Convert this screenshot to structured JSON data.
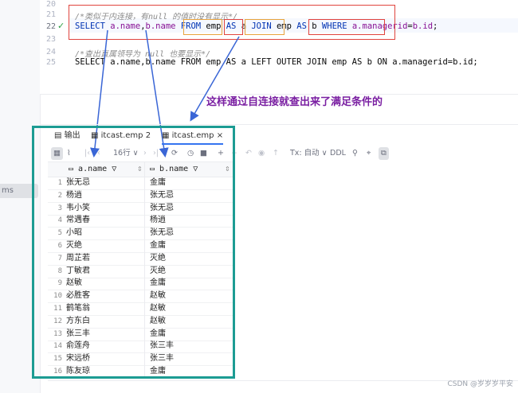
{
  "sidebar": {
    "label": "ms"
  },
  "editor": {
    "line_numbers": [
      "20",
      "21",
      "22",
      "23",
      "24",
      "25"
    ],
    "comment1": "/*类似于内连接，有null 的值时没有显示*/",
    "comment2": "/*查出直属领导为 null 也要显示*/",
    "sql1": {
      "select": "SELECT",
      "f1": "a.name",
      "comma": ",",
      "f2": "b.name",
      "from": "FROM",
      "t1": "emp",
      "as1": "AS",
      "a1": "a",
      "join": "JOIN",
      "t2": "emp",
      "as2": "AS",
      "b1": "b",
      "where": "WHERE",
      "cond1": "a.managerid",
      "eq": "=",
      "cond2": "b.id",
      "semi": ";"
    },
    "sql2": "SELECT a.name,b.name FROM emp AS a LEFT OUTER JOIN emp AS b ON a.managerid=b.id;"
  },
  "annotation": "这样通过自连接就查出来了满足条件的",
  "panel": {
    "tabs": [
      {
        "label": "输出"
      },
      {
        "label": "itcast.emp 2"
      },
      {
        "label": "itcast.emp"
      }
    ],
    "toolbar": {
      "rows": "16行 ∨",
      "tx": "Tx: 自动 ∨",
      "ddl": "DDL"
    }
  },
  "grid": {
    "columns": [
      "a.name",
      "b.name"
    ],
    "rows": [
      [
        "张无忌",
        "金庸"
      ],
      [
        "杨逍",
        "张无忌"
      ],
      [
        "韦小笑",
        "张无忌"
      ],
      [
        "常遇春",
        "杨逍"
      ],
      [
        "小昭",
        "张无忌"
      ],
      [
        "灭绝",
        "金庸"
      ],
      [
        "周芷若",
        "灭绝"
      ],
      [
        "丁敏君",
        "灭绝"
      ],
      [
        "赵敏",
        "金庸"
      ],
      [
        "必胜客",
        "赵敏"
      ],
      [
        "鹤笔翁",
        "赵敏"
      ],
      [
        "方东白",
        "赵敏"
      ],
      [
        "张三丰",
        "金庸"
      ],
      [
        "俞莲舟",
        "张三丰"
      ],
      [
        "宋远桥",
        "张三丰"
      ],
      [
        "陈友琼",
        "金庸"
      ]
    ]
  },
  "watermark": "CSDN @岁岁岁平安",
  "colors": {
    "annotation_box_red": "#e0443e",
    "annotation_box_orange": "#e8a33d",
    "result_box_teal": "#1c9c93",
    "annotation_text": "#7a1fa2",
    "keyword": "#0033b3",
    "field": "#871094"
  }
}
